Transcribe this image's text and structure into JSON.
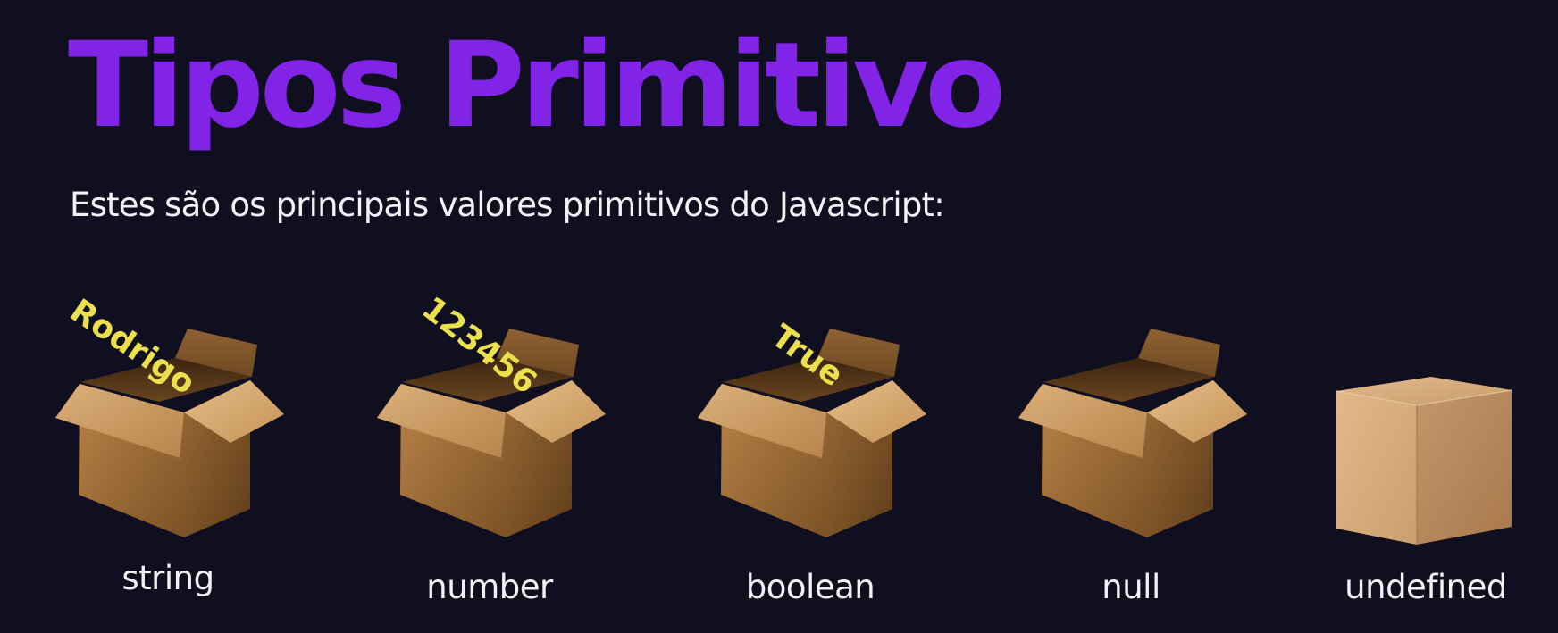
{
  "title": "Tipos Primitivo",
  "subtitle": "Estes são os principais valores primitivos do Javascript:",
  "colors": {
    "background": "#100f1f",
    "title": "#8124e8",
    "value_text": "#ece04f",
    "label_text": "#f2f2f6"
  },
  "types": [
    {
      "label": "string",
      "value": "Rodrigo",
      "box_icon": "open-box-icon"
    },
    {
      "label": "number",
      "value": "123456",
      "box_icon": "open-box-icon"
    },
    {
      "label": "boolean",
      "value": "True",
      "box_icon": "open-box-icon"
    },
    {
      "label": "null",
      "box_icon": "open-box-icon"
    },
    {
      "label": "undefined",
      "box_icon": "closed-box-icon"
    }
  ]
}
